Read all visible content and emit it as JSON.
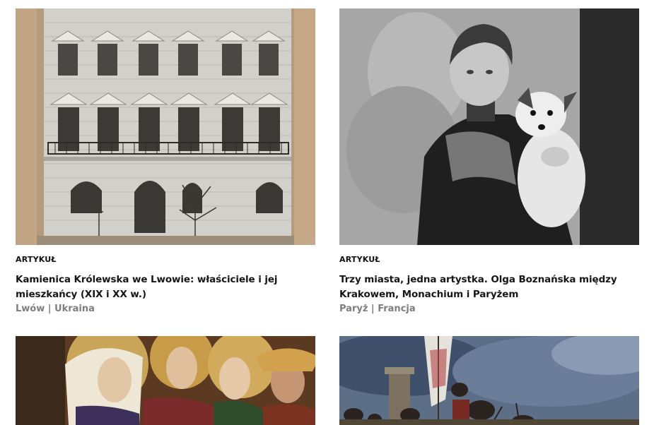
{
  "cards": [
    {
      "kind": "ARTYKUŁ",
      "title": "Kamienica Królewska we Lwowie: właściciele i jej mieszkańcy (XIX i XX w.)",
      "place": "Lwów | Ukraina",
      "image_alt": "building-facade-photo"
    },
    {
      "kind": "ARTYKUŁ",
      "title": "Trzy miasta, jedna artystka. Olga Boznańska między Krakowem, Monachium i Paryżem",
      "place": "Paryż | Francja",
      "image_alt": "portrait-woman-with-dog-photo"
    },
    {
      "kind": "",
      "title": "",
      "place": "",
      "image_alt": "medieval-painting-figures"
    },
    {
      "kind": "",
      "title": "",
      "place": "",
      "image_alt": "battle-painting-banners"
    }
  ]
}
